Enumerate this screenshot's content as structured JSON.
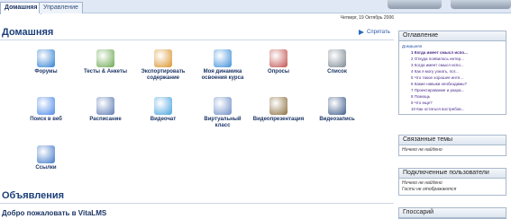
{
  "tabs": [
    {
      "label": "Домашняя",
      "active": true
    },
    {
      "label": "Управление",
      "active": false
    }
  ],
  "date": "Четверг, 19 Октябрь 2006",
  "page_title": "Домашняя",
  "hide_link": "Спрятать",
  "tools": [
    {
      "label": "Форумы",
      "icon": "forum-icon",
      "color": "#2f7fd1"
    },
    {
      "label": "Тесты & Анкеты",
      "icon": "checklist-icon",
      "color": "#6aa84f"
    },
    {
      "label": "Экспортировать содержание",
      "icon": "export-box-icon",
      "color": "#d9932b"
    },
    {
      "label": "Моя динамика освоения курса",
      "icon": "progress-chart-icon",
      "color": "#3d8fd9"
    },
    {
      "label": "Опросы",
      "icon": "survey-icon",
      "color": "#c0504d"
    },
    {
      "label": "Список",
      "icon": "user-list-icon",
      "color": "#7b8793"
    },
    {
      "label": "Поиск в веб",
      "icon": "google-search-icon",
      "color": "#4a86e8"
    },
    {
      "label": "Расписание",
      "icon": "schedule-icon",
      "color": "#5b79b4"
    },
    {
      "label": "Видеочат",
      "icon": "video-chat-icon",
      "color": "#4aa3df"
    },
    {
      "label": "Виртуальный класс",
      "icon": "virtual-class-icon",
      "color": "#6d8fc7"
    },
    {
      "label": "Видеопрезентация",
      "icon": "video-presentation-icon",
      "color": "#8a6d3b"
    },
    {
      "label": "Видеозапись",
      "icon": "video-record-icon",
      "color": "#3c5a8a"
    },
    {
      "label": "Ссылки",
      "icon": "links-icon",
      "color": "#3f78c8"
    }
  ],
  "announcements_title": "Объявления",
  "welcome": "Добро пожаловать в VitaLMS",
  "toc": {
    "title": "Оглавление",
    "root": "Домашняя",
    "items": [
      "1 Когда имеет смысл испо...",
      "2 Откуда появилось интер...",
      "3 Когда имеет смысл испо...",
      "4 Как я могу узнать, пот...",
      "5 Что такое хорошее инте...",
      "6 Какие навыки необходимы?",
      "7 Проектирование и разра...",
      "8 Помощь",
      "9 Что еще?",
      "10 Как остаться востребов..."
    ]
  },
  "related": {
    "title": "Связанные темы",
    "empty": "Ничего не найдено"
  },
  "connected": {
    "title": "Подключенные пользователи",
    "empty": "Ничего не найдено",
    "hidden": "Гости не отображаются"
  },
  "glossary": {
    "title": "Глоссарий"
  }
}
